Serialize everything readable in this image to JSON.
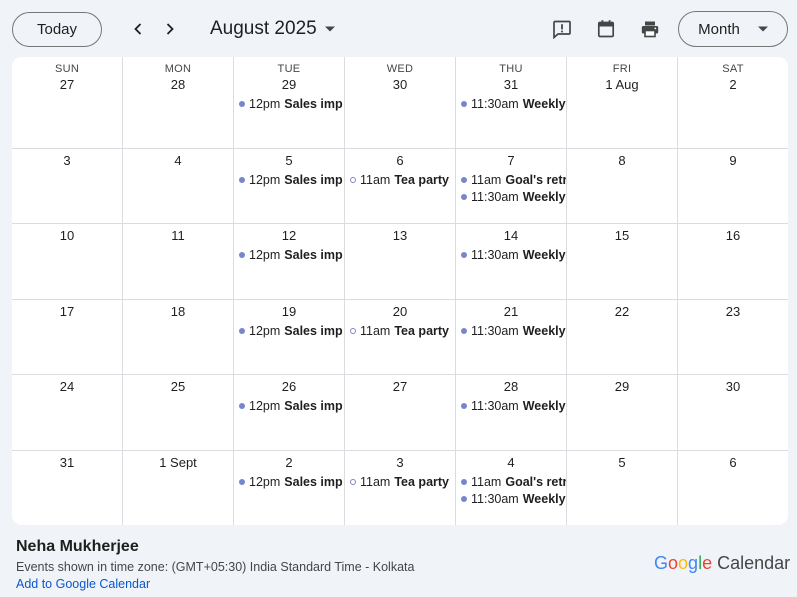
{
  "toolbar": {
    "today_label": "Today",
    "month_title": "August 2025",
    "view_label": "Month"
  },
  "weekdays": [
    "SUN",
    "MON",
    "TUE",
    "WED",
    "THU",
    "FRI",
    "SAT"
  ],
  "weeks": [
    {
      "days": [
        {
          "label": "27",
          "events": []
        },
        {
          "label": "28",
          "events": []
        },
        {
          "label": "29",
          "events": [
            {
              "time": "12pm",
              "title": "Sales imp",
              "style": "filled"
            }
          ]
        },
        {
          "label": "30",
          "events": []
        },
        {
          "label": "31",
          "events": [
            {
              "time": "11:30am",
              "title": "Weekly",
              "style": "filled"
            }
          ]
        },
        {
          "label": "1 Aug",
          "events": []
        },
        {
          "label": "2",
          "events": []
        }
      ]
    },
    {
      "days": [
        {
          "label": "3",
          "events": []
        },
        {
          "label": "4",
          "events": []
        },
        {
          "label": "5",
          "events": [
            {
              "time": "12pm",
              "title": "Sales imp",
              "style": "filled"
            }
          ]
        },
        {
          "label": "6",
          "events": [
            {
              "time": "11am",
              "title": "Tea party",
              "style": "hollow"
            }
          ]
        },
        {
          "label": "7",
          "events": [
            {
              "time": "11am",
              "title": "Goal's retr",
              "style": "filled"
            },
            {
              "time": "11:30am",
              "title": "Weekly",
              "style": "filled"
            }
          ]
        },
        {
          "label": "8",
          "events": []
        },
        {
          "label": "9",
          "events": []
        }
      ]
    },
    {
      "days": [
        {
          "label": "10",
          "events": []
        },
        {
          "label": "11",
          "events": []
        },
        {
          "label": "12",
          "events": [
            {
              "time": "12pm",
              "title": "Sales imp",
              "style": "filled"
            }
          ]
        },
        {
          "label": "13",
          "events": []
        },
        {
          "label": "14",
          "events": [
            {
              "time": "11:30am",
              "title": "Weekly",
              "style": "filled"
            }
          ]
        },
        {
          "label": "15",
          "events": []
        },
        {
          "label": "16",
          "events": []
        }
      ]
    },
    {
      "days": [
        {
          "label": "17",
          "events": []
        },
        {
          "label": "18",
          "events": []
        },
        {
          "label": "19",
          "events": [
            {
              "time": "12pm",
              "title": "Sales imp",
              "style": "filled"
            }
          ]
        },
        {
          "label": "20",
          "events": [
            {
              "time": "11am",
              "title": "Tea party",
              "style": "hollow"
            }
          ]
        },
        {
          "label": "21",
          "events": [
            {
              "time": "11:30am",
              "title": "Weekly",
              "style": "filled"
            }
          ]
        },
        {
          "label": "22",
          "events": []
        },
        {
          "label": "23",
          "events": []
        }
      ]
    },
    {
      "days": [
        {
          "label": "24",
          "events": []
        },
        {
          "label": "25",
          "events": []
        },
        {
          "label": "26",
          "events": [
            {
              "time": "12pm",
              "title": "Sales imp",
              "style": "filled"
            }
          ]
        },
        {
          "label": "27",
          "events": []
        },
        {
          "label": "28",
          "events": [
            {
              "time": "11:30am",
              "title": "Weekly",
              "style": "filled"
            }
          ]
        },
        {
          "label": "29",
          "events": []
        },
        {
          "label": "30",
          "events": []
        }
      ]
    },
    {
      "days": [
        {
          "label": "31",
          "events": []
        },
        {
          "label": "1 Sept",
          "events": []
        },
        {
          "label": "2",
          "events": [
            {
              "time": "12pm",
              "title": "Sales imp",
              "style": "filled"
            }
          ]
        },
        {
          "label": "3",
          "events": [
            {
              "time": "11am",
              "title": "Tea party",
              "style": "hollow"
            }
          ]
        },
        {
          "label": "4",
          "events": [
            {
              "time": "11am",
              "title": "Goal's retr",
              "style": "filled"
            },
            {
              "time": "11:30am",
              "title": "Weekly",
              "style": "filled"
            }
          ]
        },
        {
          "label": "5",
          "events": []
        },
        {
          "label": "6",
          "events": []
        }
      ]
    }
  ],
  "footer": {
    "owner_name": "Neha Mukherjee",
    "timezone_text": "Events shown in time zone: (GMT+05:30) India Standard Time - Kolkata",
    "add_link": "Add to Google Calendar"
  },
  "brand": {
    "letters": [
      "G",
      "o",
      "o",
      "g",
      "l",
      "e"
    ],
    "letter_colors": [
      "#4285f4",
      "#ea4335",
      "#fbbc05",
      "#4285f4",
      "#34a853",
      "#ea4335"
    ],
    "product": "Calendar"
  },
  "colors": {
    "event_dot": "#7986cb",
    "link": "#0b57d0",
    "background": "#f0f4f9"
  },
  "icons": {
    "prev": "chevron-left-icon",
    "next": "chevron-right-icon",
    "title_caret": "caret-down-icon",
    "feedback": "feedback-icon",
    "calendar": "calendar-icon",
    "print": "print-icon",
    "view_caret": "caret-down-icon"
  }
}
